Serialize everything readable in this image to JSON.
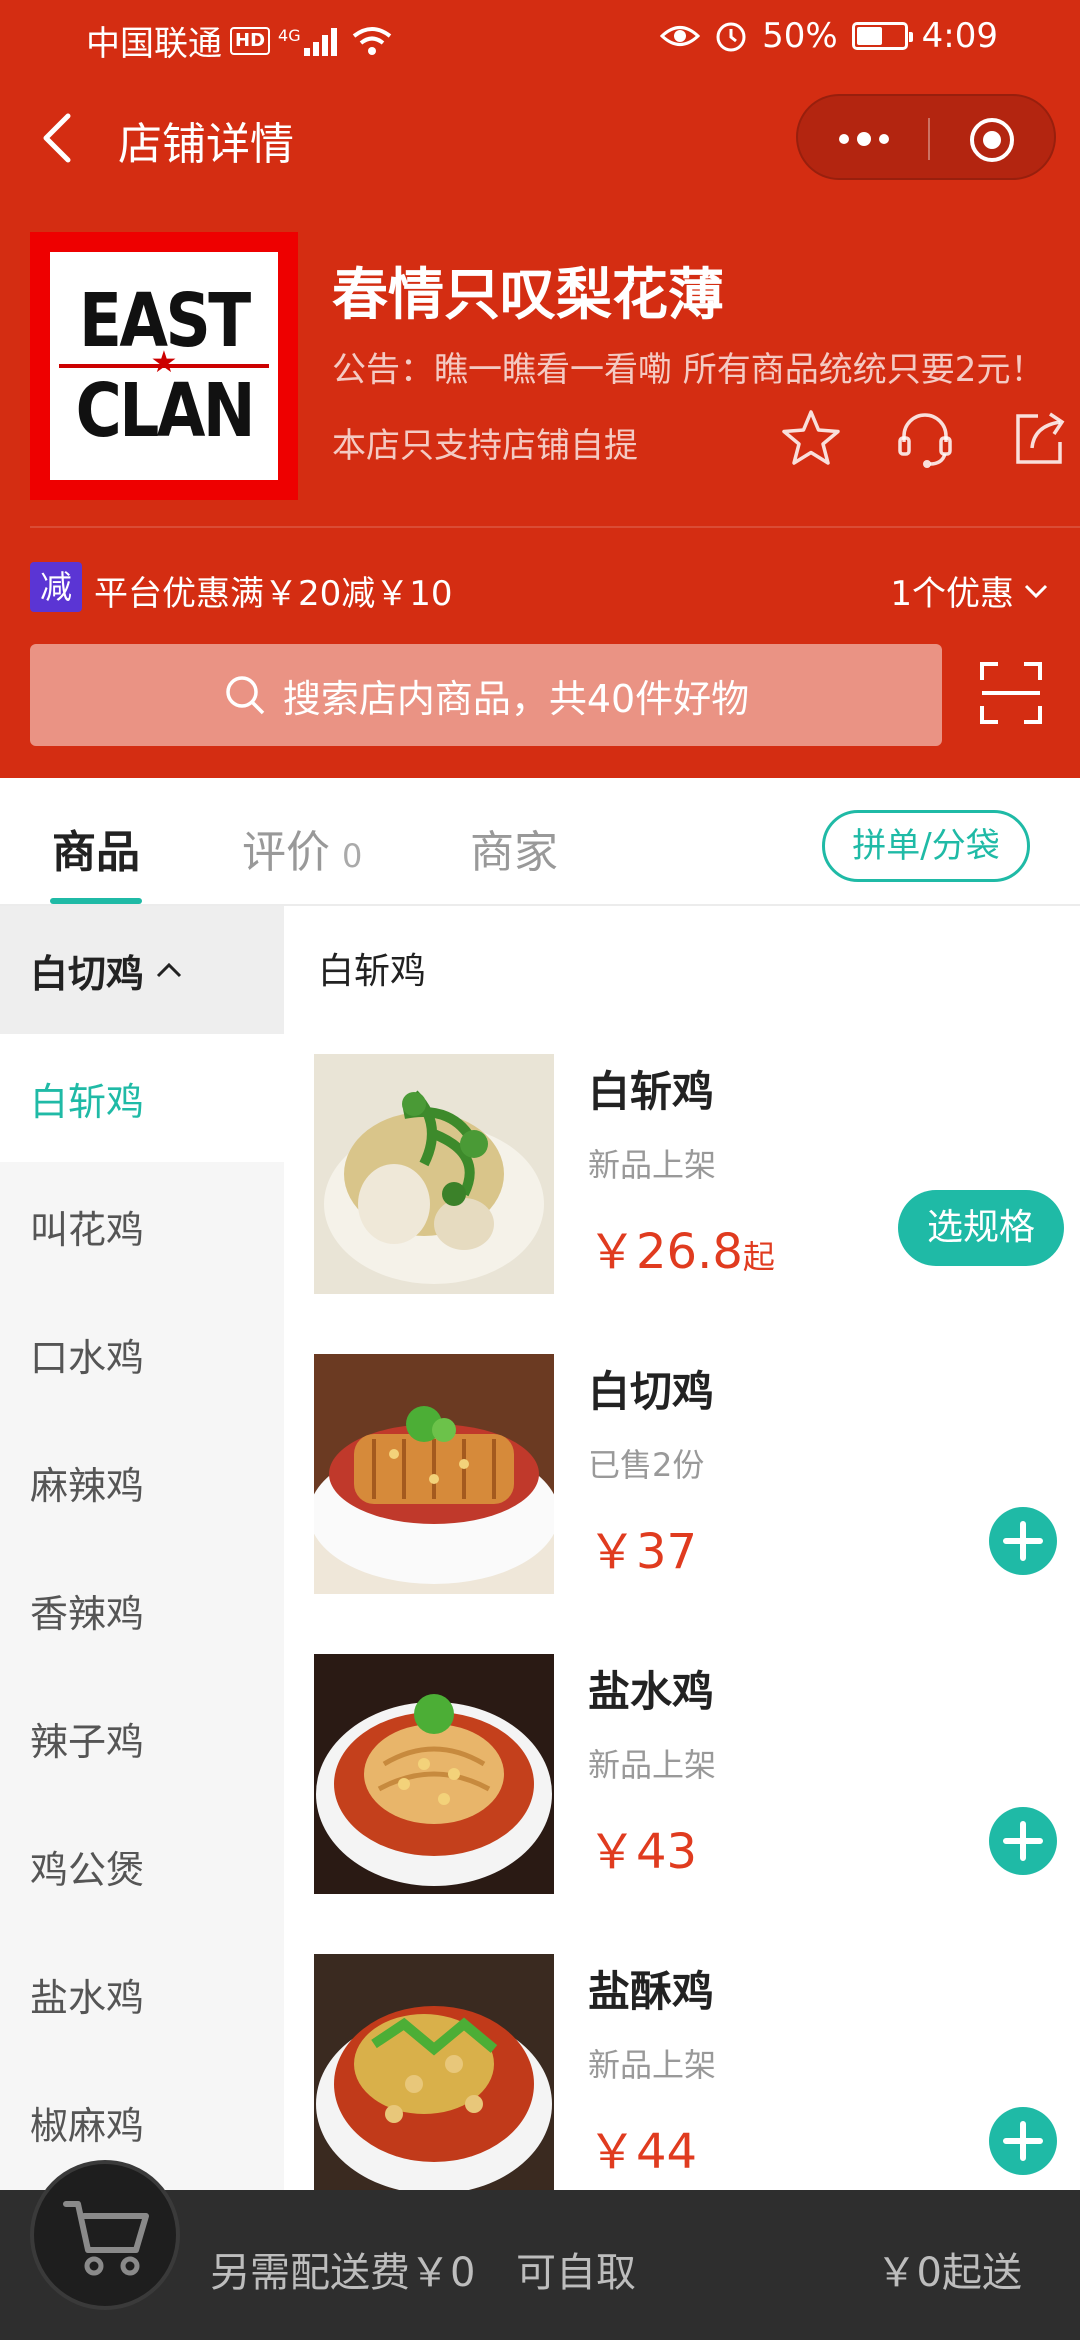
{
  "status_bar": {
    "carrier": "中国联通",
    "hd": "HD",
    "network": "4G",
    "battery": "50%",
    "time": "4:09"
  },
  "nav": {
    "title": "店铺详情"
  },
  "store": {
    "logo_line1": "EAST",
    "logo_line2": "CLAN",
    "name": "春情只叹梨花薄",
    "notice": "公告：瞧一瞧看一看嘞 所有商品统统只要2元！",
    "pickup": "本店只支持店铺自提"
  },
  "promo": {
    "badge": "减",
    "text": "平台优惠满￥20减￥10",
    "count": "1个优惠"
  },
  "search": {
    "placeholder": "搜索店内商品，共40件好物"
  },
  "tabs": {
    "goods": "商品",
    "reviews": "评价",
    "reviews_count": "0",
    "merchant": "商家",
    "group_button": "拼单/分袋"
  },
  "sidebar": {
    "group": "白切鸡",
    "items": [
      "白斩鸡",
      "叫花鸡",
      "口水鸡",
      "麻辣鸡",
      "香辣鸡",
      "辣子鸡",
      "鸡公煲",
      "盐水鸡",
      "椒麻鸡"
    ]
  },
  "content": {
    "section_title": "白斩鸡",
    "items": [
      {
        "name": "白斩鸡",
        "sub": "新品上架",
        "price": "￥26.8",
        "price_suffix": "起",
        "action": "选规格"
      },
      {
        "name": "白切鸡",
        "sub": "已售2份",
        "price": "￥37",
        "price_suffix": ""
      },
      {
        "name": "盐水鸡",
        "sub": "新品上架",
        "price": "￥43",
        "price_suffix": ""
      },
      {
        "name": "盐酥鸡",
        "sub": "新品上架",
        "price": "￥44",
        "price_suffix": ""
      }
    ]
  },
  "cart": {
    "delivery": "另需配送费￥0",
    "pickup": "可自取",
    "min_order": "￥0起送"
  },
  "colors": {
    "header_red": "#d42d12",
    "accent_teal": "#1fbaa6",
    "price_red": "#e03b1f",
    "promo_purple": "#5b35d4"
  }
}
